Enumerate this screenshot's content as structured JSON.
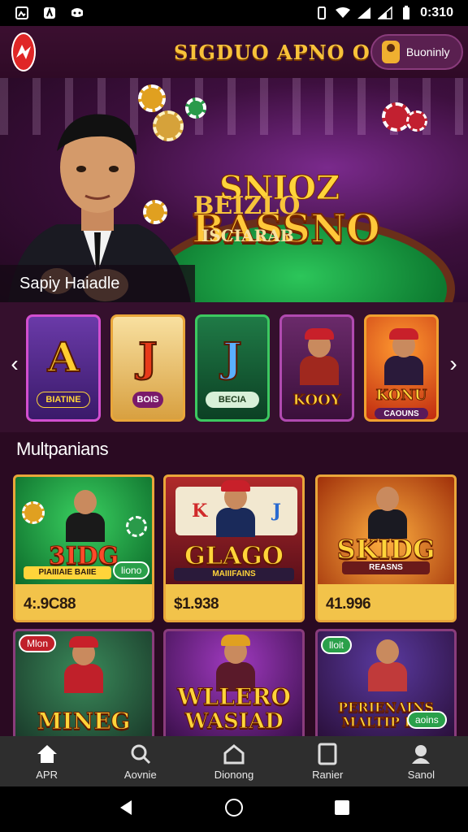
{
  "status_bar": {
    "time": "0:310",
    "left_icons": [
      "gallery-icon",
      "app-icon",
      "game-icon"
    ],
    "right_icons": [
      "vibrate-icon",
      "wifi-icon",
      "signal-icon",
      "signal-icon-2",
      "battery-icon"
    ]
  },
  "header": {
    "title": "SIGDUO APNO O",
    "pill_label": "Buoninly"
  },
  "hero": {
    "title_line1": "SNIOZ",
    "title_line2": "BASSNO",
    "subtitle1": "BEIZLO",
    "subtitle2": "ISCIARAB",
    "caption": "Sapiy Haiadle"
  },
  "carousel": {
    "tiles": [
      {
        "big": "A",
        "label": "BIATINE",
        "border": "#d24fd0",
        "bg": "#5a2a8c"
      },
      {
        "big": "J",
        "label": "BOIS",
        "border": "#e9a63a",
        "bg": "#f0d080"
      },
      {
        "big": "J",
        "label": "BECIA",
        "border": "#3cc860",
        "bg": "#1a6a3a"
      },
      {
        "big": "",
        "label": "KOOY",
        "border": "#b04ab0",
        "bg": "#5a1a5a"
      },
      {
        "big": "",
        "label": "KONU",
        "label2": "CAOUNS",
        "border": "#f0a030",
        "bg": "#e04a10"
      }
    ]
  },
  "section": {
    "title": "Multpanians"
  },
  "cards": [
    {
      "title": "3IDG",
      "sub": "PIAIIIAIE BAIIE",
      "badge": "liono",
      "price": "4:.9C88"
    },
    {
      "title": "GLAGO",
      "sub": "MAIIIFAINS",
      "price": "$1.938"
    },
    {
      "title": "SKIDG",
      "sub": "REASNS",
      "price": "41.996"
    }
  ],
  "cards_row2": [
    {
      "title": "MINEG",
      "badge": "Mlon"
    },
    {
      "title": "WLLERO",
      "title2": "WASIAD"
    },
    {
      "title": "PERIENAINS",
      "title2": "MALTIP PIA",
      "badge": "lloit",
      "badge2": "aoins"
    }
  ],
  "bottom_nav": [
    {
      "label": "APR",
      "icon": "home-icon"
    },
    {
      "label": "Aovnie",
      "icon": "search-icon"
    },
    {
      "label": "Dionong",
      "icon": "house-outline-icon"
    },
    {
      "label": "Ranier",
      "icon": "tablet-icon"
    },
    {
      "label": "Sanol",
      "icon": "profile-icon"
    }
  ],
  "colors": {
    "background": "#2a0a22",
    "accent_gold": "#f7c23a",
    "logo_red": "#e02626",
    "card_gold": "#f2c34a"
  }
}
